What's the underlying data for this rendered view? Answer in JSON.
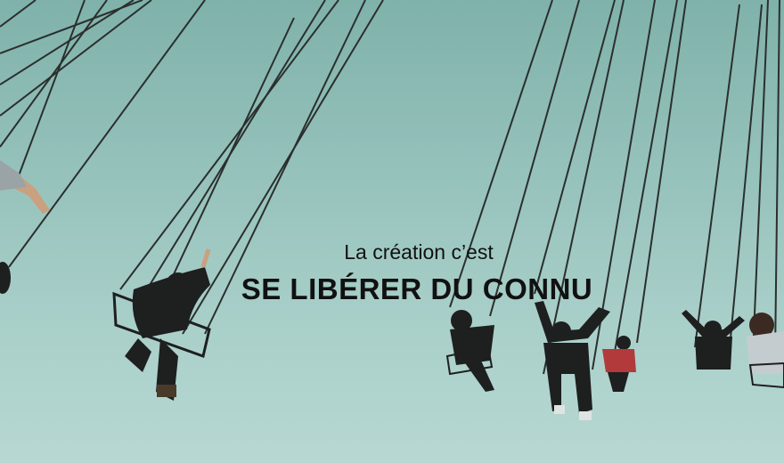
{
  "caption": {
    "line1": "La création c’est",
    "line2": "SE LIBÉRER DU CONNU"
  },
  "colors": {
    "sky_top": "#7fb2aa",
    "sky_bottom": "#b7d8d3",
    "chain": "#2b2f2e",
    "rider_dark": "#1e1f1f",
    "rider_red": "#b23a3a",
    "text": "#111111"
  }
}
